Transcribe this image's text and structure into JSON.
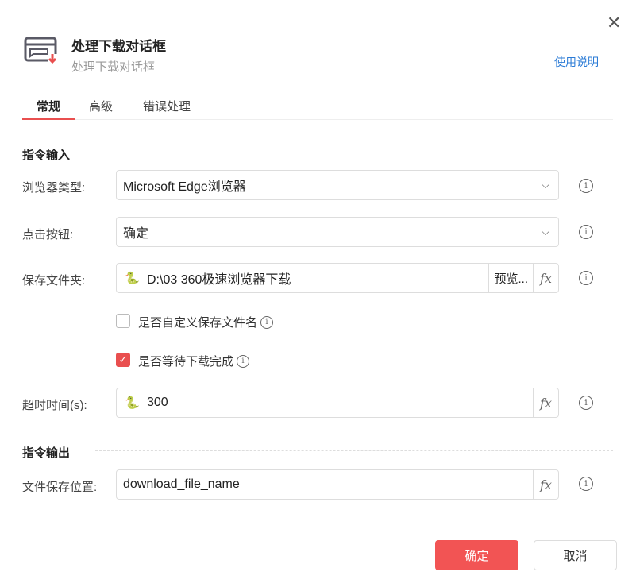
{
  "dialog": {
    "title": "处理下载对话框",
    "subtitle": "处理下载对话框",
    "help": "使用说明",
    "close": "✕"
  },
  "tabs": [
    {
      "label": "常规"
    },
    {
      "label": "高级"
    },
    {
      "label": "错误处理"
    }
  ],
  "input_section": "指令输入",
  "output_section": "指令输出",
  "fields": {
    "browser": {
      "label": "浏览器类型:",
      "value": "Microsoft Edge浏览器"
    },
    "button": {
      "label": "点击按钮:",
      "value": "确定"
    },
    "folder": {
      "label": "保存文件夹:",
      "value": "D:\\03 360极速浏览器下载",
      "browse": "预览..."
    },
    "custom_name": {
      "label": "是否自定义保存文件名",
      "checked": false
    },
    "wait": {
      "label": "是否等待下载完成",
      "checked": true
    },
    "timeout": {
      "label": "超时时间(s):",
      "value": "300"
    },
    "save_location": {
      "label": "文件保存位置:",
      "value": "download_file_name"
    }
  },
  "fx": "fx",
  "info": "i",
  "footer": {
    "ok": "确定",
    "cancel": "取消"
  }
}
